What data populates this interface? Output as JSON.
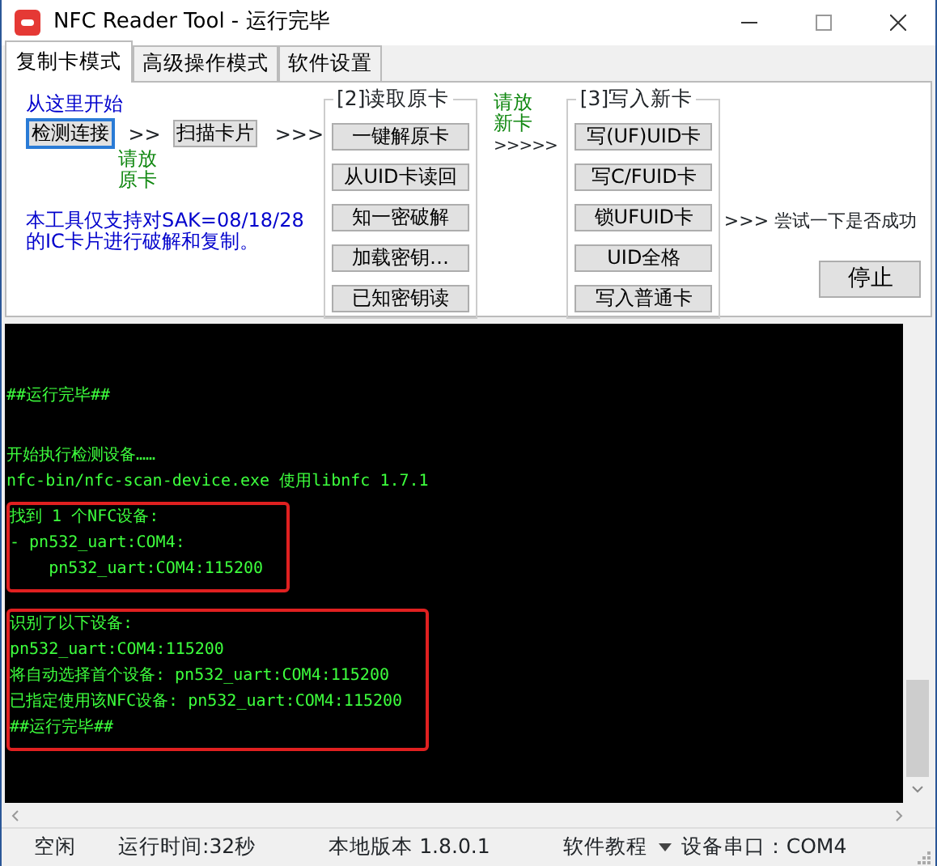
{
  "window": {
    "title": "NFC Reader Tool - 运行完毕"
  },
  "tabs": [
    {
      "label": "复制卡模式",
      "selected": true
    },
    {
      "label": "高级操作模式",
      "selected": false
    },
    {
      "label": "软件设置",
      "selected": false
    }
  ],
  "copy_mode": {
    "start_hint": "从这里开始",
    "detect_button": {
      "label": "检测连接",
      "focused": true
    },
    "arrow_1": ">>",
    "scan_button": "扫描卡片",
    "arrow_2": ">>>",
    "place_original_hint": [
      "请放",
      "原卡"
    ],
    "notice": [
      "本工具仅支持对SAK=08/18/28",
      "的IC卡片进行破解和复制。"
    ],
    "read_group": {
      "title": "[2]读取原卡",
      "buttons": [
        "一键解原卡",
        "从UID卡读回",
        "知一密破解",
        "加载密钥…",
        "已知密钥读"
      ]
    },
    "place_new_hint": [
      "请放",
      "新卡"
    ],
    "arrow_3": ">>>>>",
    "write_group": {
      "title": "[3]写入新卡",
      "buttons": [
        "写(UF)UID卡",
        "写C/FUID卡",
        "锁UFUID卡",
        "UID全格",
        "写入普通卡"
      ]
    },
    "try_hint": ">>> 尝试一下是否成功",
    "stop_button": "停止"
  },
  "console": {
    "blocks": [
      {
        "highlighted": false,
        "lines": [
          "##运行完毕##"
        ]
      },
      {
        "highlighted": false,
        "lines": [
          "开始执行检测设备……",
          "nfc-bin/nfc-scan-device.exe 使用libnfc 1.7.1"
        ]
      },
      {
        "highlighted": true,
        "lines": [
          "找到 1 个NFC设备:",
          "- pn532_uart:COM4:",
          "    pn532_uart:COM4:115200"
        ]
      },
      {
        "highlighted": true,
        "lines": [
          "识别了以下设备:",
          "pn532_uart:COM4:115200",
          "将自动选择首个设备: pn532_uart:COM4:115200",
          "已指定使用该NFC设备: pn532_uart:COM4:115200",
          "##运行完毕##"
        ]
      }
    ]
  },
  "status_bar": {
    "items": [
      {
        "kind": "text",
        "text": "空闲"
      },
      {
        "kind": "text",
        "text": "运行时间:32秒"
      },
      {
        "kind": "text",
        "text": "本地版本 1.8.0.1"
      },
      {
        "kind": "dropdown",
        "text": "软件教程"
      },
      {
        "kind": "text",
        "text": "设备串口：COM4"
      }
    ]
  }
}
